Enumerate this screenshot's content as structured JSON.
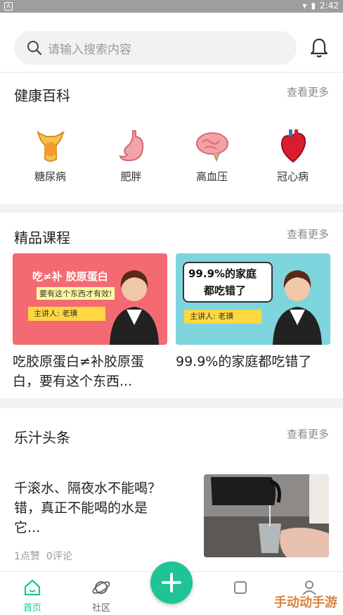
{
  "status_bar": {
    "time": "2:42",
    "app_icon_letter": "A"
  },
  "search": {
    "placeholder": "请输入搜索内容"
  },
  "health_wiki": {
    "title": "健康百科",
    "more_label": "查看更多",
    "items": [
      {
        "label": "糖尿病",
        "icon": "pancreas-icon"
      },
      {
        "label": "肥胖",
        "icon": "stomach-icon"
      },
      {
        "label": "高血压",
        "icon": "brain-icon"
      },
      {
        "label": "冠心病",
        "icon": "heart-icon"
      }
    ]
  },
  "courses": {
    "title": "精品课程",
    "more_label": "查看更多",
    "items": [
      {
        "banner_line1": "吃≠补 胶原蛋白",
        "banner_line2": "要有这个东西才有效!",
        "host": "主讲人: 老璜",
        "title_line1": "吃胶原蛋白≠补胶原蛋",
        "title_line2": "白，要有这个东西..."
      },
      {
        "banner_line1": "99.9%的家庭",
        "banner_line2": "都吃错了",
        "host": "主讲人: 老璜",
        "title_line1": "99.9%的家庭都吃错了",
        "title_line2": ""
      }
    ]
  },
  "headlines": {
    "title": "乐汁头条",
    "more_label": "查看更多",
    "item": {
      "title_line1": "千滚水、隔夜水不能喝？",
      "title_line2": "错，真正不能喝的水是",
      "title_line3": "它...",
      "likes": "1点赞",
      "comments": "0评论"
    }
  },
  "tabbar": {
    "home_label": "首页",
    "community_label": "社区"
  },
  "watermark": "手动动手游",
  "colors": {
    "accent": "#1fc496",
    "banner1_bg": "#f46a72",
    "banner2_bg": "#7fd5dd"
  }
}
